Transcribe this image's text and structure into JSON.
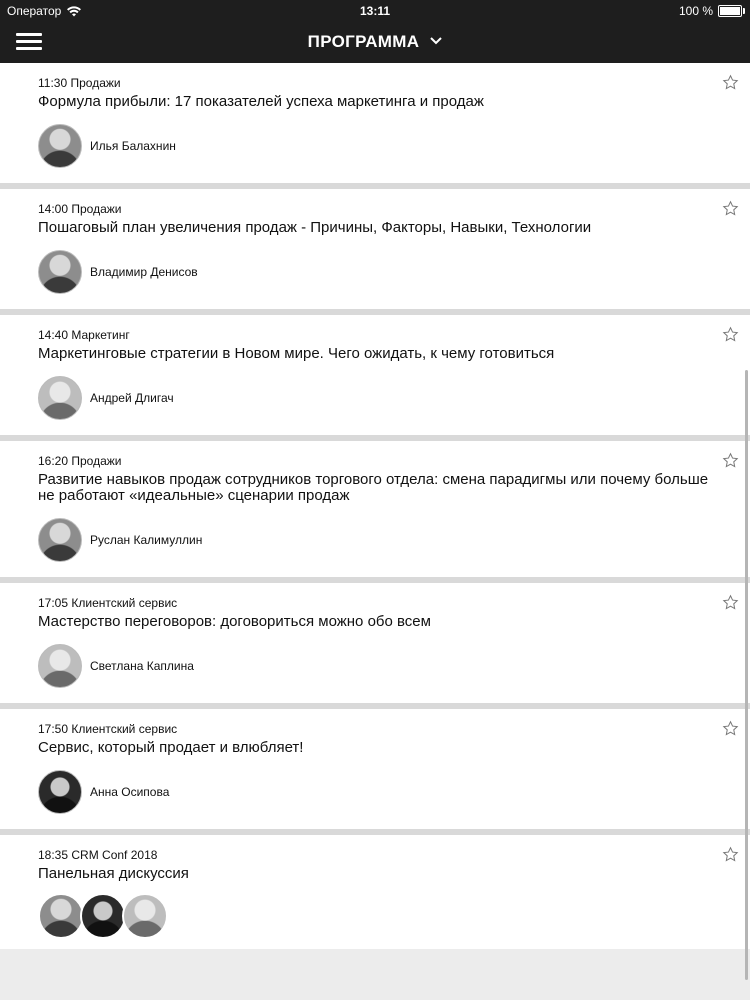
{
  "status_bar": {
    "carrier": "Оператор",
    "time": "13:11",
    "battery": "100 %"
  },
  "nav": {
    "title": "ПРОГРАММА"
  },
  "sessions": [
    {
      "time": "11:30",
      "track": "Продажи",
      "title": "Формула прибыли: 17 показателей успеха маркетинга и продаж",
      "speakers": [
        "Илья Балахнин"
      ]
    },
    {
      "time": "14:00",
      "track": "Продажи",
      "title": "Пошаговый план увеличения продаж - Причины, Факторы, Навыки, Технологии",
      "speakers": [
        "Владимир Денисов"
      ]
    },
    {
      "time": "14:40",
      "track": "Маркетинг",
      "title": "Маркетинговые стратегии в Новом мире. Чего ожидать, к чему готовиться",
      "speakers": [
        "Андрей Длигач"
      ]
    },
    {
      "time": "16:20",
      "track": "Продажи",
      "title": "Развитие навыков продаж сотрудников торгового отдела: смена парадигмы или почему больше не работают «идеальные» сценарии продаж",
      "speakers": [
        "Руслан Калимуллин"
      ]
    },
    {
      "time": "17:05",
      "track": "Клиентский сервис",
      "title": "Мастерство переговоров: договориться можно обо всем",
      "speakers": [
        "Светлана Каплина"
      ]
    },
    {
      "time": "17:50",
      "track": "Клиентский сервис",
      "title": "Сервис, который продает и влюбляет!",
      "speakers": [
        "Анна Осипова"
      ]
    },
    {
      "time": "18:35",
      "track": "CRM Conf 2018",
      "title": "Панельная дискуссия",
      "speakers": []
    }
  ]
}
